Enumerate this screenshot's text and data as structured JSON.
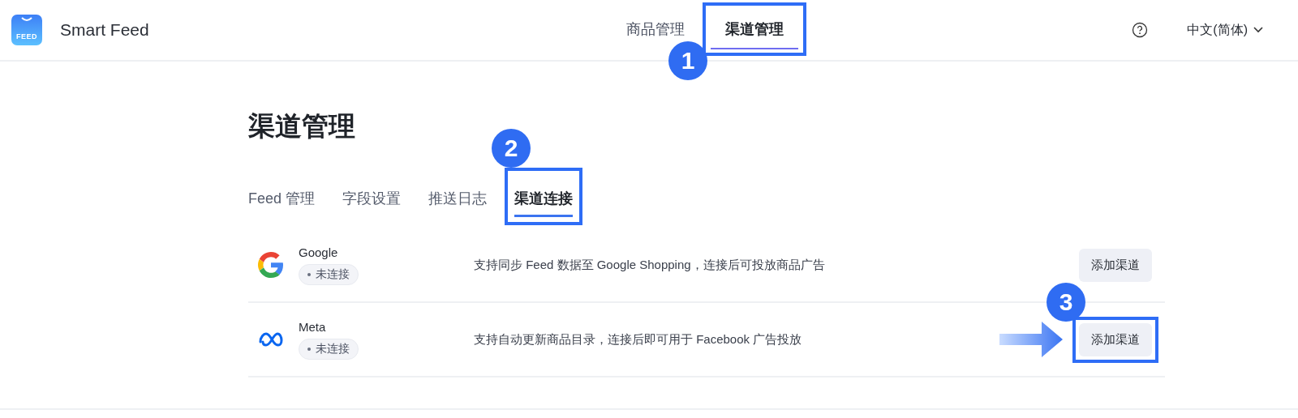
{
  "header": {
    "logo_text": "FEED",
    "app_name": "Smart Feed",
    "nav": [
      {
        "label": "商品管理",
        "selected": false
      },
      {
        "label": "渠道管理",
        "selected": true,
        "callout": "1"
      }
    ],
    "language": "中文(简体)"
  },
  "page": {
    "title": "渠道管理",
    "tabs": [
      {
        "label": "Feed 管理",
        "selected": false
      },
      {
        "label": "字段设置",
        "selected": false
      },
      {
        "label": "推送日志",
        "selected": false
      },
      {
        "label": "渠道连接",
        "selected": true,
        "callout": "2"
      }
    ],
    "channels": [
      {
        "kind": "google",
        "name": "Google",
        "status": "未连接",
        "description": "支持同步 Feed 数据至 Google Shopping，连接后可投放商品广告",
        "button": "添加渠道"
      },
      {
        "kind": "meta",
        "name": "Meta",
        "status": "未连接",
        "description": "支持自动更新商品目录，连接后即可用于 Facebook 广告投放",
        "button": "添加渠道",
        "callout": "3",
        "arrow": true
      }
    ]
  }
}
